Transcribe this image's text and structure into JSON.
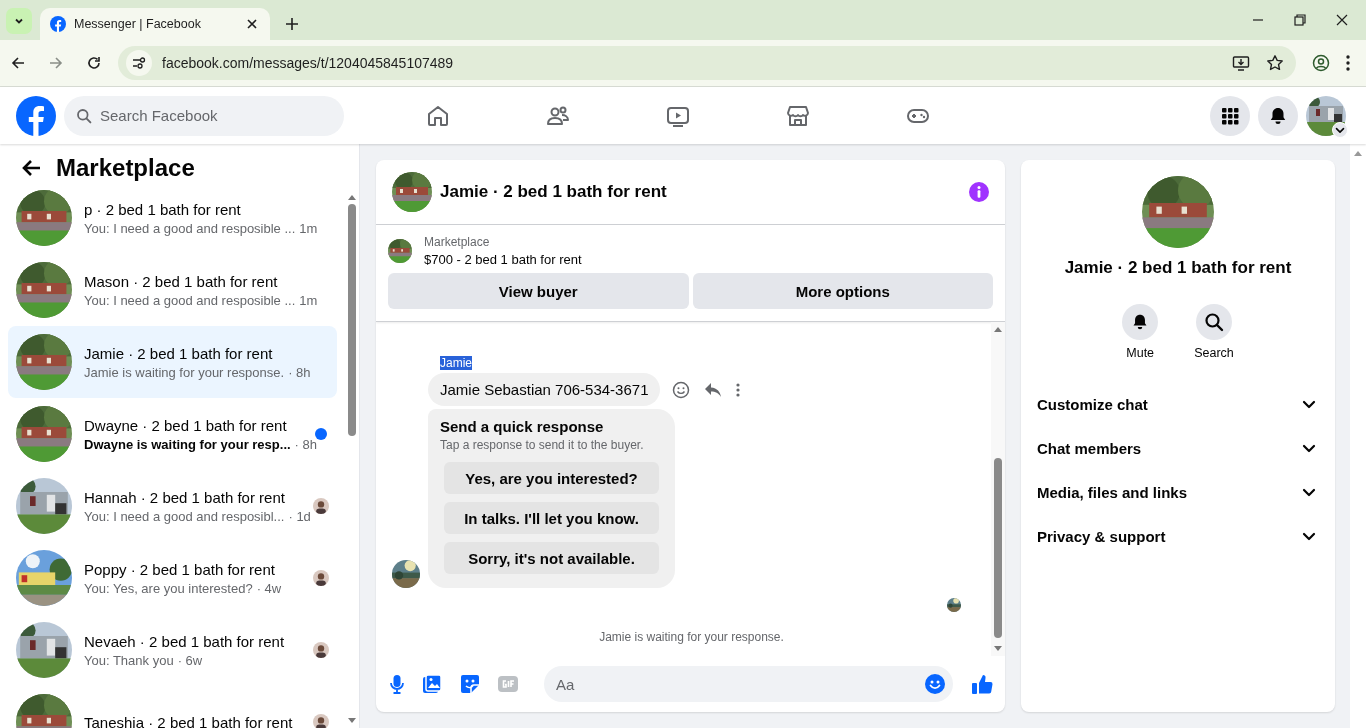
{
  "browser": {
    "tab": {
      "title": "Messenger | Facebook"
    },
    "address": "facebook.com/messages/t/1204045845107489"
  },
  "topbar": {
    "search_placeholder": "Search Facebook"
  },
  "sidebar": {
    "title": "Marketplace",
    "conversations": [
      {
        "title": "p · 2 bed 1 bath for rent",
        "preview": "You: I need a good and resposible ...",
        "time": "1m",
        "selected": false,
        "unread": false,
        "seen": false
      },
      {
        "title": "Mason · 2 bed 1 bath for rent",
        "preview": "You: I need a good and resposible ...",
        "time": "1m",
        "selected": false,
        "unread": false,
        "seen": false
      },
      {
        "title": "Jamie · 2 bed 1 bath for rent",
        "preview": "Jamie is waiting for your response.",
        "time": "· 8h",
        "selected": true,
        "unread": false,
        "seen": false
      },
      {
        "title": "Dwayne · 2 bed 1 bath for rent",
        "preview": "Dwayne is waiting for your resp...",
        "time": "· 8h",
        "selected": false,
        "unread": true,
        "seen": false
      },
      {
        "title": "Hannah · 2 bed 1 bath for rent",
        "preview": "You: I need a good and resposibl...",
        "time": "· 1d",
        "selected": false,
        "unread": false,
        "seen": true
      },
      {
        "title": "Poppy · 2 bed 1 bath for rent",
        "preview": "You: Yes, are you interested?",
        "time": "· 4w",
        "selected": false,
        "unread": false,
        "seen": true
      },
      {
        "title": "Nevaeh · 2 bed 1 bath for rent",
        "preview": "You: Thank you",
        "time": "· 6w",
        "selected": false,
        "unread": false,
        "seen": true
      },
      {
        "title": "Taneshia · 2 bed 1 bath for rent",
        "selected": false,
        "unread": false,
        "seen": true
      }
    ]
  },
  "chat": {
    "title": "Jamie · 2 bed 1 bath for rent",
    "listing": {
      "source": "Marketplace",
      "name": "$700 - 2 bed 1 bath for rent"
    },
    "buttons": [
      "View buyer",
      "More options"
    ],
    "sender": {
      "name": "Jamie",
      "highlighted": true
    },
    "message": "Jamie Sebastian 706-534-3671",
    "quick_response": {
      "title": "Send a quick response",
      "hint": "Tap a response to send it to the buyer.",
      "options": [
        "Yes, are you interested?",
        "In talks. I'll let you know.",
        "Sorry, it's not available."
      ]
    },
    "status": "Jamie is waiting for your response.",
    "composer": {
      "placeholder": "Aa"
    }
  },
  "info": {
    "title": "Jamie · 2 bed 1 bath for rent",
    "actions": [
      "Mute",
      "Search"
    ],
    "sections": [
      {
        "label": "Customize chat",
        "expanded": false
      },
      {
        "label": "Chat members",
        "expanded": false
      },
      {
        "label": "Media, files and links",
        "expanded": false
      },
      {
        "label": "Privacy & support",
        "expanded": false
      }
    ]
  }
}
